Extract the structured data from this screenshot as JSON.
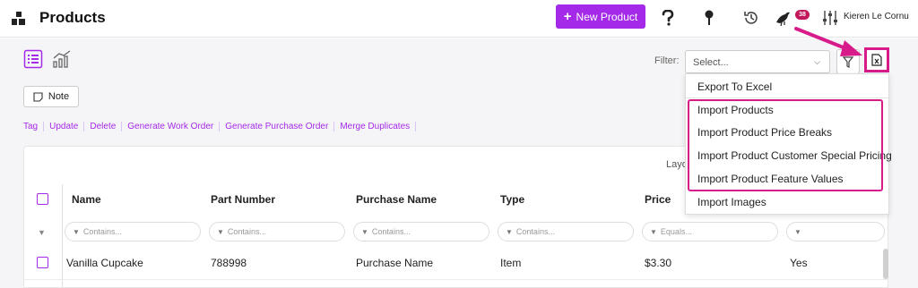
{
  "header": {
    "title": "Products",
    "new_button": "New Product",
    "badge_count": "38",
    "user_name": "Kieren Le Cornu"
  },
  "toolbar": {
    "filter_label": "Filter:",
    "filter_placeholder": "Select...",
    "note_button": "Note"
  },
  "actions": [
    "Tag",
    "Update",
    "Delete",
    "Generate Work Order",
    "Generate Purchase Order",
    "Merge Duplicates"
  ],
  "grid": {
    "layout_label": "Layo",
    "columns": [
      "Name",
      "Part Number",
      "Purchase Name",
      "Type",
      "Price"
    ],
    "filters": [
      "Contains...",
      "Contains...",
      "Contains...",
      "Contains...",
      "Equals...",
      ""
    ],
    "row": [
      "Vanilla Cupcake",
      "788998",
      "Purchase Name",
      "Item",
      "$3.30",
      "Yes"
    ]
  },
  "dropdown": {
    "items": [
      "Export To Excel",
      "Import Products",
      "Import Product Price Breaks",
      "Import Product Customer Special Pricing",
      "Import Product Feature Values",
      "Import Images"
    ]
  },
  "colors": {
    "accent": "#a429e8",
    "highlight": "#d81b8a",
    "badge": "#c2185b"
  }
}
